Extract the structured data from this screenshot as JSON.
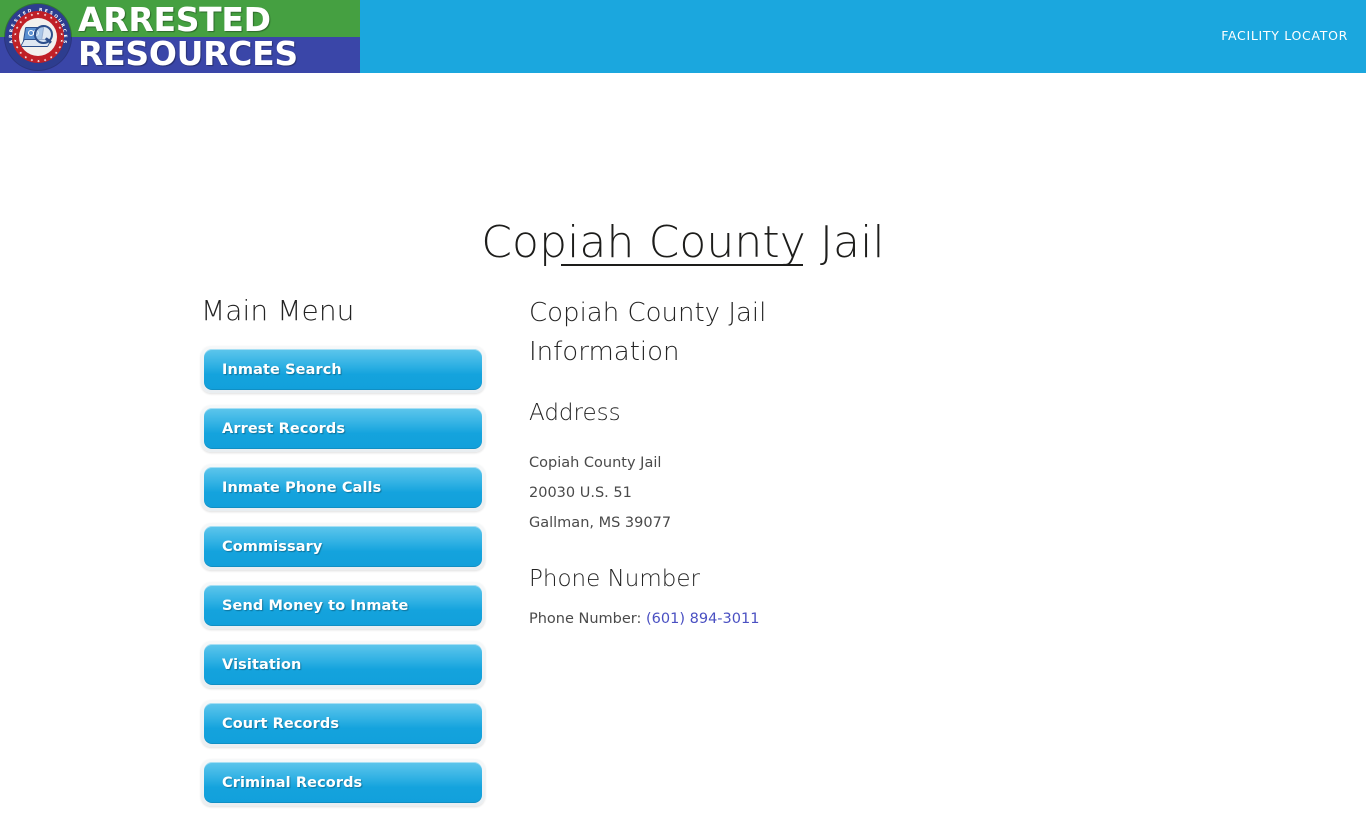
{
  "header": {
    "brand": {
      "line1": "ARRESTED",
      "line2": "RESOURCES",
      "badge_ring_text": "ARRESTED RESOURCES",
      "green": "#45a041",
      "dark_blue": "#3a46a8",
      "bar_blue": "#1ba7de"
    },
    "nav": {
      "facility_locator": "FACILITY LOCATOR"
    }
  },
  "page": {
    "title": "Copiah County Jail"
  },
  "menu": {
    "heading": "Main Menu",
    "items": [
      {
        "label": "Inmate Search"
      },
      {
        "label": "Arrest Records"
      },
      {
        "label": "Inmate Phone Calls"
      },
      {
        "label": "Commissary"
      },
      {
        "label": "Send Money to Inmate"
      },
      {
        "label": "Visitation"
      },
      {
        "label": "Court Records"
      },
      {
        "label": "Criminal Records"
      }
    ]
  },
  "info": {
    "title": "Copiah County Jail Information",
    "address_heading": "Address",
    "address": {
      "line1": "Copiah County Jail",
      "line2": "20030 U.S. 51",
      "line3": "Gallman, MS 39077"
    },
    "phone_heading": "Phone Number",
    "phone_label": "Phone Number:",
    "phone_value": "(601) 894-3011",
    "link_color": "#4a50c2"
  }
}
